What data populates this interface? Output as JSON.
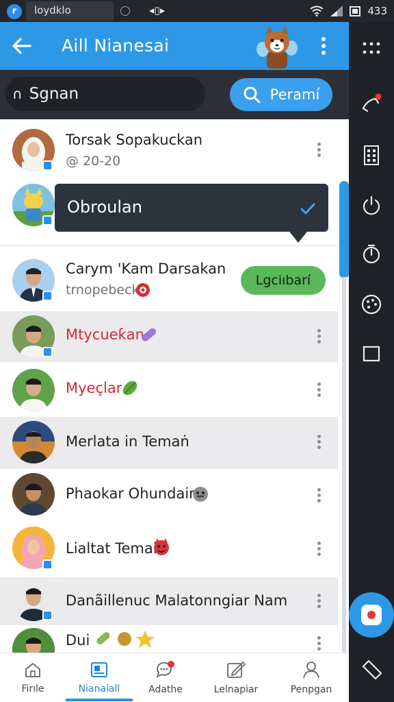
{
  "status_bar": {
    "app_icon": "r",
    "app_name": "loydklo",
    "time": "433"
  },
  "header": {
    "title": "Aill Nianesai"
  },
  "search": {
    "cap_glyph": "∩",
    "value": "Sgnan",
    "button_label": "Peramí"
  },
  "contacts": [
    {
      "name": "Torsak Sopakuckan",
      "sub": "@ 20-20"
    },
    {
      "name": "Obroulan",
      "selected": true
    },
    {
      "name": "Carym 'Kam Darsakan",
      "sub": "trnopebeck",
      "action": "Lgciıbarí"
    },
    {
      "name": "Mtycueƙan"
    },
    {
      "name": "Myeçlar"
    },
    {
      "name": "Merlata in Temaṅ"
    },
    {
      "name": "Phaokar Ohundain"
    },
    {
      "name": "Lialtat Temai"
    },
    {
      "name": "Danãillenuc Malatonngiar Nam"
    },
    {
      "name": "Dui"
    }
  ],
  "bottom_nav": [
    {
      "label": "Firıle",
      "icon": "home-icon"
    },
    {
      "label": "Nianaiall",
      "icon": "contacts-icon",
      "active": true
    },
    {
      "label": "Adathe",
      "icon": "chat-icon"
    },
    {
      "label": "Lelnapiar",
      "icon": "edit-icon"
    },
    {
      "label": "Penpgan",
      "icon": "profile-icon"
    }
  ],
  "colors": {
    "brand_blue": "#2d98e6",
    "dark_panel": "#2c3036",
    "accent_red": "#d6283a",
    "pill_green": "#5ab75a"
  }
}
